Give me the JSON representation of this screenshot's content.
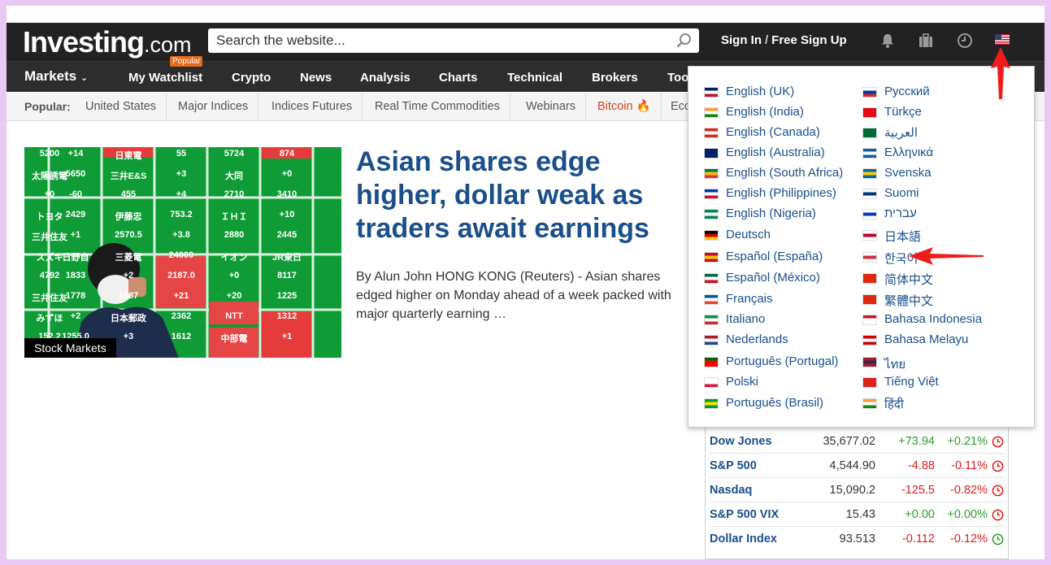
{
  "header": {
    "logo_main": "Investing",
    "logo_suffix": ".com",
    "search_placeholder": "Search the website...",
    "signin_label": "Sign In",
    "signup_label": "Free Sign Up",
    "signin_separator": "/",
    "icons": [
      "bell-icon",
      "briefcase-icon",
      "clock-icon",
      "us-flag-icon"
    ]
  },
  "nav": {
    "markets_label": "Markets",
    "popular_badge": "Popular",
    "items": [
      "My Watchlist",
      "Crypto",
      "News",
      "Analysis",
      "Charts",
      "Technical",
      "Brokers",
      "Too"
    ]
  },
  "subnav": {
    "label": "Popular:",
    "items": [
      "United States",
      "Major Indices",
      "Indices Futures",
      "Real Time Commodities",
      "Webinars",
      "Bitcoin",
      "Eco"
    ]
  },
  "article": {
    "category_tag": "Stock Markets",
    "headline": "Asian shares edge higher, dollar weak as traders await earnings",
    "summary": "By Alun John HONG KONG (Reuters) - Asian shares edged higher on Monday ahead of a week packed with major quarterly earning  …"
  },
  "board": {
    "cells": [
      [
        "5200",
        "+14",
        "日東電",
        "55",
        "5724",
        "874"
      ],
      [
        "太陽誘電",
        "5650",
        "三井E&S",
        "+3",
        "大同",
        "+0"
      ],
      [
        "+0",
        "-60",
        "455",
        "+4",
        "2710",
        "3410"
      ],
      [
        "トヨタ",
        "2429",
        "伊藤忠",
        "753.2",
        "ＩＨＩ",
        "+10"
      ],
      [
        "三井住友",
        "+1",
        "2570.5",
        "+3.8",
        "2880",
        "2445"
      ],
      [
        "スズキ",
        "日野自",
        "三菱電",
        "24000",
        "イオン",
        "JR東日"
      ],
      [
        "4792",
        "1833",
        "+2",
        "2187.0",
        "+0",
        "8117"
      ],
      [
        "三井住友",
        "1778",
        "1687",
        "+21",
        "+20",
        "1225"
      ],
      [
        "みずほ",
        "+2",
        "日本郵政",
        "2362",
        "NTT",
        "1312"
      ],
      [
        "152.2",
        "1255.0",
        "+3",
        "1612",
        "中部電",
        "+1"
      ]
    ]
  },
  "indices": [
    {
      "name": "Dow Jones",
      "value": "35,677.02",
      "change": "+73.94",
      "pct": "+0.21%",
      "dir": "pos",
      "clock": "red"
    },
    {
      "name": "S&P 500",
      "value": "4,544.90",
      "change": "-4.88",
      "pct": "-0.11%",
      "dir": "neg",
      "clock": "red"
    },
    {
      "name": "Nasdaq",
      "value": "15,090.2",
      "change": "-125.5",
      "pct": "-0.82%",
      "dir": "neg",
      "clock": "red"
    },
    {
      "name": "S&P 500 VIX",
      "value": "15.43",
      "change": "+0.00",
      "pct": "+0.00%",
      "dir": "pos",
      "clock": "red"
    },
    {
      "name": "Dollar Index",
      "value": "93.513",
      "change": "-0.112",
      "pct": "-0.12%",
      "dir": "neg",
      "clock": "green"
    }
  ],
  "languages": {
    "col1": [
      "English (UK)",
      "English (India)",
      "English (Canada)",
      "English (Australia)",
      "English (South Africa)",
      "English (Philippines)",
      "English (Nigeria)",
      "Deutsch",
      "Español (España)",
      "Español (México)",
      "Français",
      "Italiano",
      "Nederlands",
      "Português (Portugal)",
      "Polski",
      "Português (Brasil)"
    ],
    "col2": [
      "Русский",
      "Türkçe",
      "العربية",
      "Ελληνικά",
      "Svenska",
      "Suomi",
      "עברית",
      "日本語",
      "한국어",
      "简体中文",
      "繁體中文",
      "Bahasa Indonesia",
      "Bahasa Melayu",
      "ไทย",
      "Tiếng Việt",
      "हिंदी"
    ],
    "col1_flags": [
      "uk-flag-icon",
      "india-flag-icon",
      "canada-flag-icon",
      "australia-flag-icon",
      "south-africa-flag-icon",
      "philippines-flag-icon",
      "nigeria-flag-icon",
      "germany-flag-icon",
      "spain-flag-icon",
      "mexico-flag-icon",
      "france-flag-icon",
      "italy-flag-icon",
      "netherlands-flag-icon",
      "portugal-flag-icon",
      "poland-flag-icon",
      "brazil-flag-icon"
    ],
    "col2_flags": [
      "russia-flag-icon",
      "turkey-flag-icon",
      "saudi-flag-icon",
      "greece-flag-icon",
      "sweden-flag-icon",
      "finland-flag-icon",
      "israel-flag-icon",
      "japan-flag-icon",
      "korea-flag-icon",
      "china-flag-icon",
      "hong-kong-flag-icon",
      "indonesia-flag-icon",
      "malaysia-flag-icon",
      "thailand-flag-icon",
      "vietnam-flag-icon",
      "india-hindi-flag-icon"
    ]
  },
  "colors": {
    "header_bg": "#222222",
    "link_blue": "#1a4f8b",
    "positive": "#2a9d29",
    "negative": "#e21b1b",
    "annotation_arrow": "#ee1c1c",
    "frame_border": "#e9c9f3"
  }
}
